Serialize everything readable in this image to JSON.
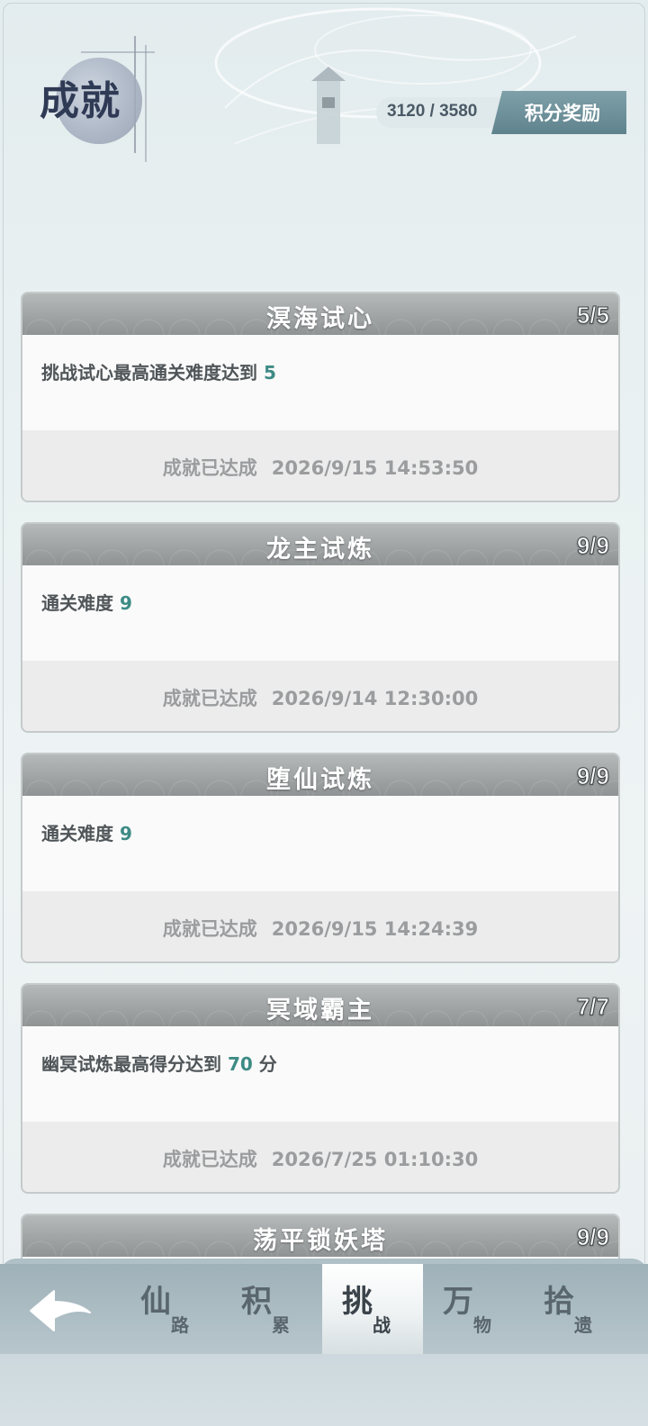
{
  "header": {
    "title": "成就",
    "score": "3120 / 3580",
    "reward_label": "积分奖励"
  },
  "cards": [
    {
      "title": "溟海试心",
      "count": "5/5",
      "desc_text": "挑战试心最高通关难度达到 ",
      "desc_value": "5",
      "desc_suffix": "",
      "status": "成就已达成",
      "time": "2026/9/15 14:53:50"
    },
    {
      "title": "龙主试炼",
      "count": "9/9",
      "desc_text": "通关难度 ",
      "desc_value": "9",
      "desc_suffix": "",
      "status": "成就已达成",
      "time": "2026/9/14 12:30:00"
    },
    {
      "title": "堕仙试炼",
      "count": "9/9",
      "desc_text": "通关难度 ",
      "desc_value": "9",
      "desc_suffix": "",
      "status": "成就已达成",
      "time": "2026/9/15 14:24:39"
    },
    {
      "title": "冥域霸主",
      "count": "7/7",
      "desc_text": "幽冥试炼最高得分达到 ",
      "desc_value": "70",
      "desc_suffix": " 分",
      "status": "成就已达成",
      "time": "2026/7/25 01:10:30"
    },
    {
      "title": "荡平锁妖塔",
      "count": "9/9"
    }
  ],
  "nav": {
    "tabs": [
      {
        "main": "仙",
        "sub": "路"
      },
      {
        "main": "积",
        "sub": "累"
      },
      {
        "main": "挑",
        "sub": "战"
      },
      {
        "main": "万",
        "sub": "物"
      },
      {
        "main": "拾",
        "sub": "遗"
      }
    ],
    "active_index": 2
  },
  "colors": {
    "highlight": "#3d8b85",
    "reward_button": "#6b8e97",
    "title_ink": "#2f3a55"
  }
}
